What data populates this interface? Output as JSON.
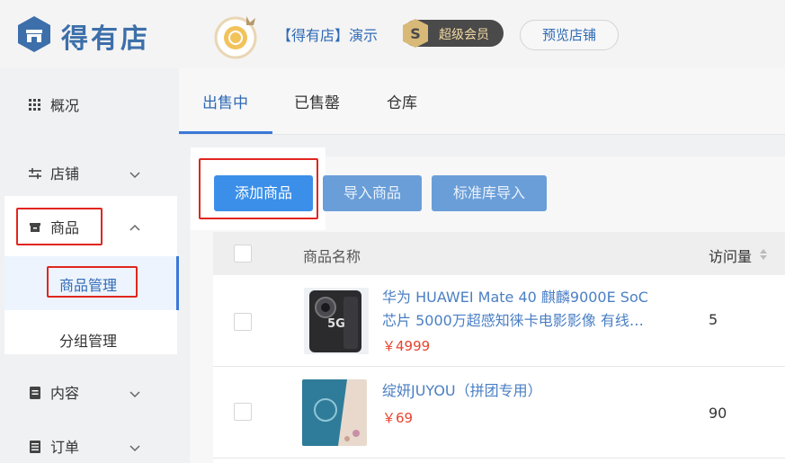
{
  "header": {
    "logo_text": "得有店",
    "shop_name": "【得有店】演示",
    "vip_label": "超级会员",
    "preview_button": "预览店铺",
    "brand_color": "#3d6faa"
  },
  "sidebar": {
    "items": [
      {
        "label": "概况",
        "icon": "grid-icon"
      },
      {
        "label": "店铺",
        "icon": "sliders-icon"
      },
      {
        "label": "商品",
        "icon": "box-icon"
      },
      {
        "label": "内容",
        "icon": "document-icon"
      },
      {
        "label": "订单",
        "icon": "list-icon"
      }
    ],
    "sub_items": [
      {
        "label": "商品管理",
        "active": true
      },
      {
        "label": "分组管理",
        "active": false
      }
    ]
  },
  "tabs": [
    {
      "label": "出售中",
      "active": true
    },
    {
      "label": "已售罄",
      "active": false
    },
    {
      "label": "仓库",
      "active": false
    }
  ],
  "actions": {
    "add": "添加商品",
    "import": "导入商品",
    "std_import": "标准库导入"
  },
  "table": {
    "columns": {
      "name": "商品名称",
      "visits": "访问量"
    },
    "rows": [
      {
        "name_line1": "华为 HUAWEI Mate 40 麒麟9000E SoC",
        "name_line2": "芯片 5000万超感知徕卡电影影像 有线…",
        "price": "￥4999",
        "visits": "5"
      },
      {
        "name_line1": "绽妍JUYOU（拼团专用）",
        "name_line2": "",
        "price": "￥69",
        "visits": "90"
      }
    ]
  },
  "colors": {
    "accent": "#3b78d8",
    "price": "#e8432d",
    "highlight_box": "#e0261f"
  }
}
